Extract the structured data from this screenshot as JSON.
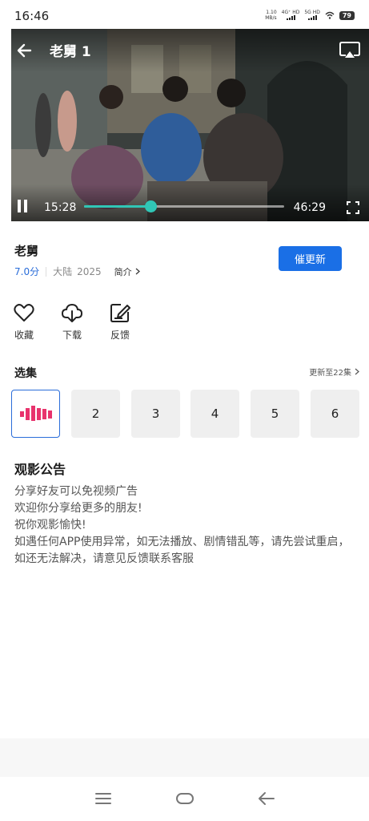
{
  "status_bar": {
    "time": "16:46",
    "net_speed_value": "1.10",
    "net_speed_unit": "MB/s",
    "signal_1": "4G⁺ HD",
    "signal_2": "5G HD",
    "battery": "79"
  },
  "player": {
    "title": "老舅 1",
    "current_time": "15:28",
    "total_time": "46:29",
    "progress_fraction": 0.333,
    "accent_color": "#30c6b6"
  },
  "info": {
    "title": "老舅",
    "rating": "7.0分",
    "region": "大陆",
    "year": "2025",
    "intro_label": "简介",
    "urge_button": "催更新",
    "rating_color": "#2a6dd9",
    "button_color": "#1a6fe6"
  },
  "actions": [
    {
      "label": "收藏",
      "icon": "heart-icon"
    },
    {
      "label": "下载",
      "icon": "cloud-download-icon"
    },
    {
      "label": "反馈",
      "icon": "edit-icon"
    }
  ],
  "episodes_section": {
    "title": "选集",
    "update_text": "更新至22集",
    "playing_icon": "bars-icon",
    "playing_color": "#e8336d",
    "episodes": [
      "2",
      "3",
      "4",
      "5",
      "6"
    ]
  },
  "notice": {
    "title": "观影公告",
    "lines": [
      "分享好友可以免视频广告",
      "欢迎你分享给更多的朋友!",
      "祝你观影愉快!",
      "如遇任何APP使用异常，如无法播放、剧情错乱等，请先尝试重启，如还无法解决，请意见反馈联系客服"
    ]
  },
  "nav_icons": [
    "menu-icon",
    "home-icon",
    "back-icon"
  ]
}
